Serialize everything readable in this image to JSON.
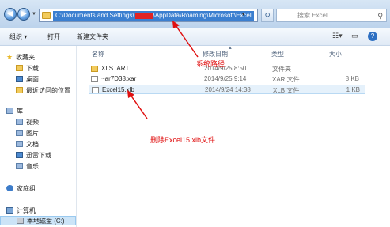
{
  "address_bar": {
    "path_prefix": "C:\\Documents and Settings\\",
    "path_suffix": "\\AppData\\Roaming\\Microsoft\\Excel",
    "search_placeholder": "搜索 Excel"
  },
  "toolbar": {
    "organize_label": "组织 ▾",
    "open_label": "打开",
    "new_folder_label": "新建文件夹"
  },
  "sidebar": {
    "favorites": "收藏夹",
    "downloads": "下载",
    "desktop": "桌面",
    "recent": "最近访问的位置",
    "libraries": "库",
    "videos": "视频",
    "pictures": "图片",
    "documents": "文档",
    "thunder": "迅雷下载",
    "music": "音乐",
    "homegroup": "家庭组",
    "computer": "计算机",
    "local_disk": "本地磁盘 (C:)"
  },
  "columns": {
    "name": "名称",
    "date": "修改日期",
    "type": "类型",
    "size": "大小"
  },
  "files": [
    {
      "name": "XLSTART",
      "date": "2014/9/25 8:50",
      "type": "文件夹",
      "size": ""
    },
    {
      "name": "~ar7D38.xar",
      "date": "2014/9/25 9:14",
      "type": "XAR 文件",
      "size": "8 KB"
    },
    {
      "name": "Excel15.xlb",
      "date": "2014/9/24 14:38",
      "type": "XLB 文件",
      "size": "1 KB"
    }
  ],
  "annotations": {
    "system_path": "系统路径",
    "delete_file": "删除Excel15.xlb文件"
  },
  "colors": {
    "annotation_red": "#e01010",
    "address_highlight": "#3b7fd0"
  }
}
